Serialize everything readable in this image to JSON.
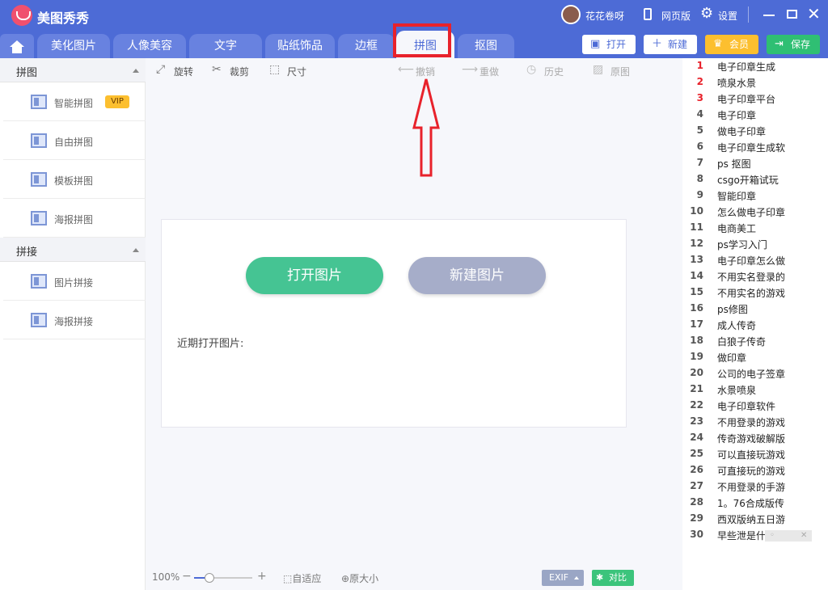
{
  "titlebar": {
    "app_title": "美图秀秀",
    "user_name": "花花卷呀",
    "web_version": "网页版",
    "settings": "设置",
    "close": "✕"
  },
  "tabs": [
    "美化图片",
    "人像美容",
    "文字",
    "贴纸饰品",
    "边框",
    "拼图",
    "抠图"
  ],
  "active_tab": "拼图",
  "header_buttons": {
    "open": "打开",
    "new": "新建",
    "vip": "会员",
    "save": "保存"
  },
  "left_panel": {
    "section1_title": "拼图",
    "section1_items": [
      "智能拼图",
      "自由拼图",
      "模板拼图",
      "海报拼图"
    ],
    "vip_badge": "VIP",
    "section2_title": "拼接",
    "section2_items": [
      "图片拼接",
      "海报拼接"
    ]
  },
  "toolbar": {
    "rotate": "旋转",
    "crop": "裁剪",
    "size": "尺寸",
    "undo": "撤销",
    "redo": "重做",
    "history": "历史",
    "original": "原图"
  },
  "center": {
    "open_image": "打开图片",
    "new_image": "新建图片",
    "recent_label": "近期打开图片:"
  },
  "bottom": {
    "zoom": "100%",
    "zoom_level": 0.2,
    "fit": "自适应",
    "original_size": "原大小",
    "exif": "EXIF",
    "compare": "对比"
  },
  "ranking": [
    {
      "n": "1",
      "t": "电子印章生成"
    },
    {
      "n": "2",
      "t": "喷泉水景"
    },
    {
      "n": "3",
      "t": "电子印章平台"
    },
    {
      "n": "4",
      "t": "电子印章"
    },
    {
      "n": "5",
      "t": "做电子印章"
    },
    {
      "n": "6",
      "t": "电子印章生成软"
    },
    {
      "n": "7",
      "t": "ps 抠图"
    },
    {
      "n": "8",
      "t": "csgo开箱试玩"
    },
    {
      "n": "9",
      "t": "智能印章"
    },
    {
      "n": "10",
      "t": "怎么做电子印章"
    },
    {
      "n": "11",
      "t": "电商美工"
    },
    {
      "n": "12",
      "t": "ps学习入门"
    },
    {
      "n": "13",
      "t": "电子印章怎么做"
    },
    {
      "n": "14",
      "t": "不用实名登录的"
    },
    {
      "n": "15",
      "t": "不用实名的游戏"
    },
    {
      "n": "16",
      "t": "ps修图"
    },
    {
      "n": "17",
      "t": "成人传奇"
    },
    {
      "n": "18",
      "t": "白狼子传奇"
    },
    {
      "n": "19",
      "t": "做印章"
    },
    {
      "n": "20",
      "t": "公司的电子签章"
    },
    {
      "n": "21",
      "t": "水景喷泉"
    },
    {
      "n": "22",
      "t": "电子印章软件"
    },
    {
      "n": "23",
      "t": "不用登录的游戏"
    },
    {
      "n": "24",
      "t": "传奇游戏破解版"
    },
    {
      "n": "25",
      "t": "可以直接玩游戏"
    },
    {
      "n": "26",
      "t": "可直接玩的游戏"
    },
    {
      "n": "27",
      "t": "不用登录的手游"
    },
    {
      "n": "28",
      "t": "1。76合成版传"
    },
    {
      "n": "29",
      "t": "西双版纳五日游"
    },
    {
      "n": "30",
      "t": "早些泄是什么原"
    }
  ],
  "colors": {
    "header_blue": "#4d6bd6",
    "open_green": "#45c493",
    "new_gray": "#a6adc9",
    "highlight_red": "#e8222b",
    "vip_gold": "#fcbf2f"
  }
}
